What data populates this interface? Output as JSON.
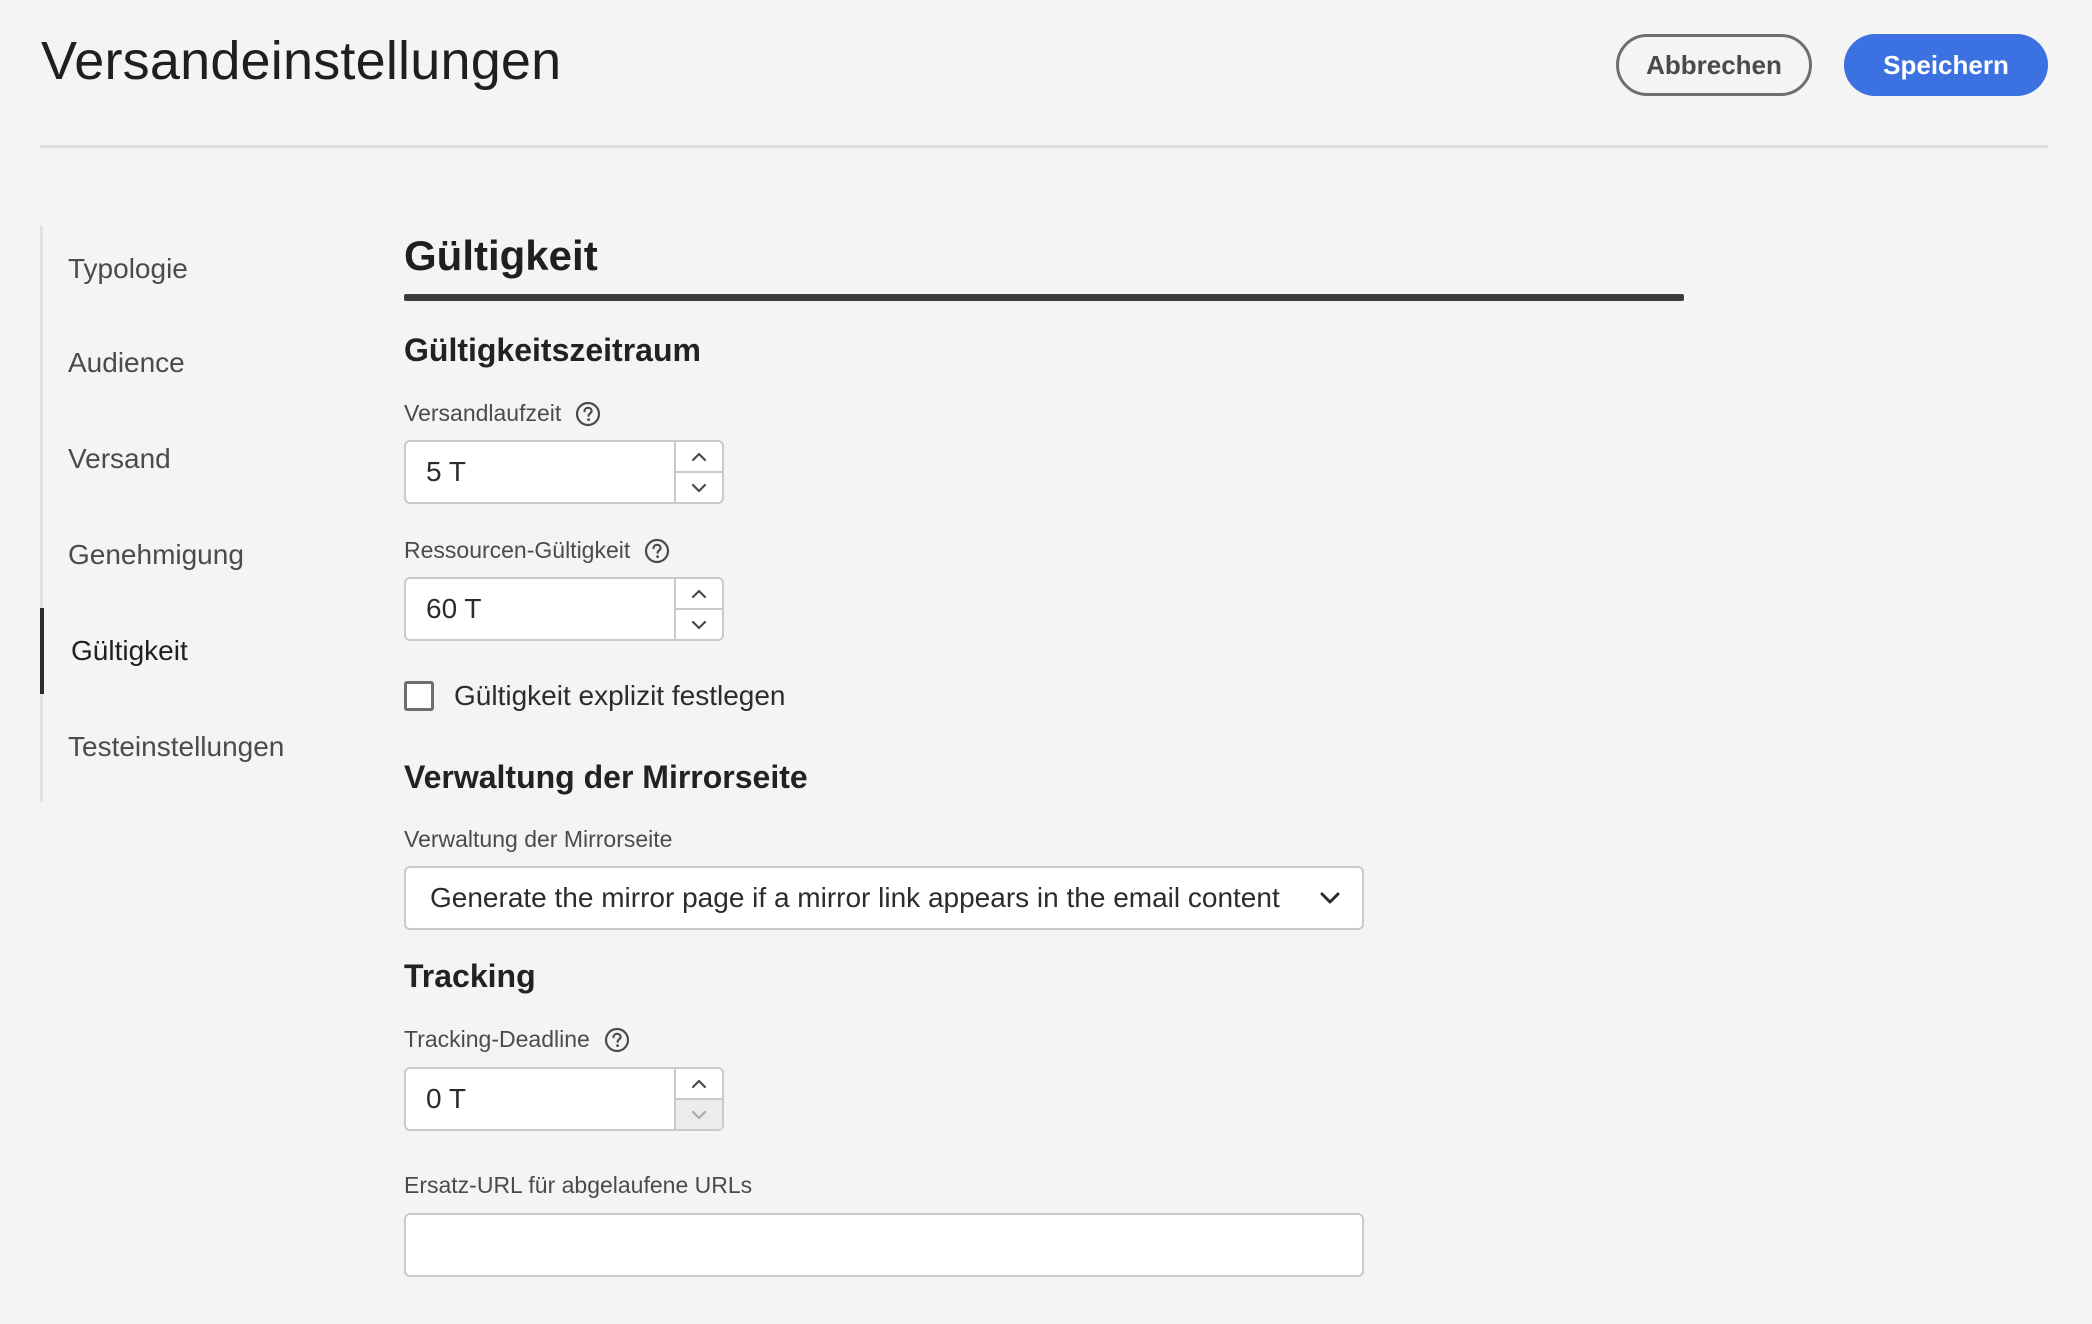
{
  "header": {
    "title": "Versandeinstellungen",
    "cancel_label": "Abbrechen",
    "save_label": "Speichern"
  },
  "sidebar": {
    "items": [
      {
        "label": "Typologie"
      },
      {
        "label": "Audience"
      },
      {
        "label": "Versand"
      },
      {
        "label": "Genehmigung"
      },
      {
        "label": "Gültigkeit"
      },
      {
        "label": "Testeinstellungen"
      }
    ],
    "active": "Gültigkeit"
  },
  "main": {
    "section_title": "Gültigkeit",
    "validity_period": {
      "heading": "Gültigkeitszeitraum",
      "delivery_duration": {
        "label": "Versandlaufzeit",
        "value": "5 T"
      },
      "resource_validity": {
        "label": "Ressourcen-Gültigkeit",
        "value": "60 T"
      },
      "explicit_checkbox": {
        "label": "Gültigkeit explizit festlegen",
        "checked": false
      }
    },
    "mirror": {
      "heading": "Verwaltung der Mirrorseite",
      "label": "Verwaltung der Mirrorseite",
      "selected": "Generate the mirror page if a mirror link appears in the email content"
    },
    "tracking": {
      "heading": "Tracking",
      "deadline": {
        "label": "Tracking-Deadline",
        "value": "0 T"
      },
      "replacement_url": {
        "label": "Ersatz-URL für abgelaufene URLs",
        "value": ""
      }
    }
  },
  "colors": {
    "background": "#f4f4f4",
    "accent": "#3b71e0",
    "text": "#2c2c2c",
    "border": "#c9c9c9"
  },
  "icons": [
    "help-icon",
    "chevron-up-icon",
    "chevron-down-icon",
    "dropdown-chevron-icon"
  ]
}
